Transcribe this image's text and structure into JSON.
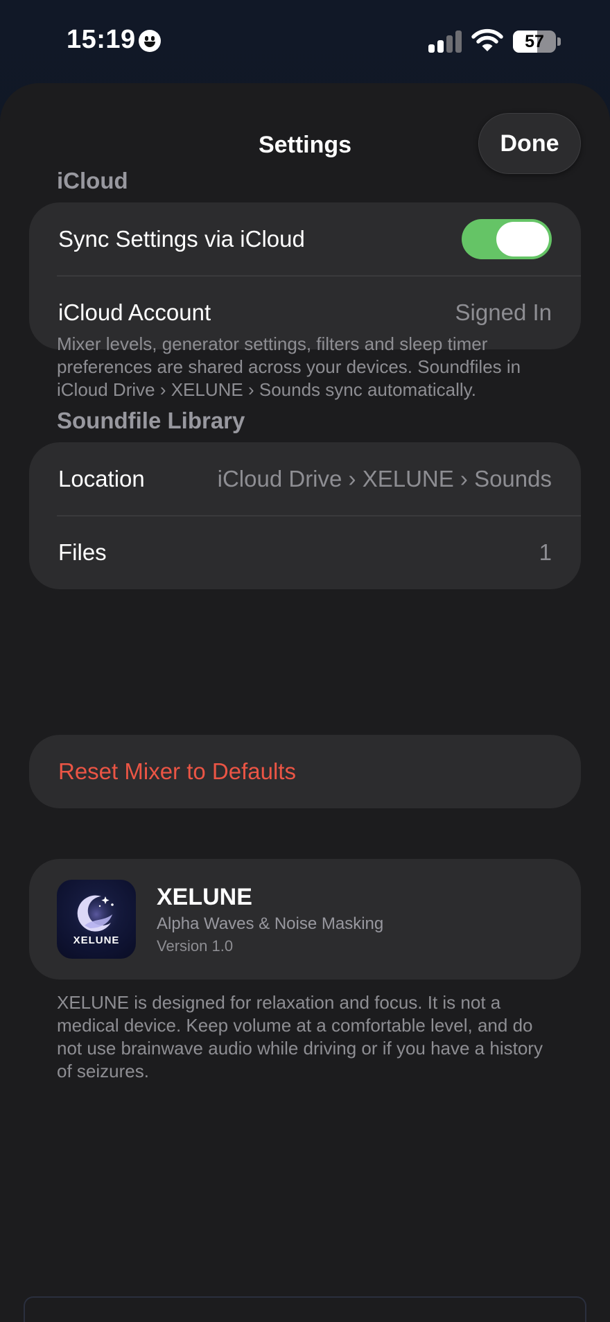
{
  "status_bar": {
    "time": "15:19",
    "battery_percent": "57",
    "battery_level": 0.57,
    "signal_bars_active": 2,
    "signal_bars_total": 4
  },
  "sheet": {
    "title": "Settings",
    "done_label": "Done"
  },
  "icloud": {
    "header": "iCloud",
    "sync_label": "Sync Settings via iCloud",
    "sync_enabled": true,
    "account_label": "iCloud Account",
    "account_value": "Signed In",
    "footnote": "Mixer levels, generator settings, filters and sleep timer preferences are shared across your devices. Soundfiles in iCloud Drive › XELUNE › Sounds sync automatically."
  },
  "library": {
    "header": "Soundfile Library",
    "location_label": "Location",
    "location_value": "iCloud Drive › XELUNE › Sounds",
    "files_label": "Files",
    "files_value": "1"
  },
  "reset": {
    "label": "Reset Mixer to Defaults"
  },
  "about": {
    "icon_text": "XELUNE",
    "app_name": "XELUNE",
    "subtitle": "Alpha Waves & Noise Masking",
    "version": "Version 1.0",
    "disclaimer": "XELUNE is designed for relaxation and focus. It is not a medical device. Keep volume at a comfortable level, and do not use brainwave audio while driving or if you have a history of seizures."
  },
  "colors": {
    "toggle_on": "#65c466",
    "destructive": "#eb5545",
    "sheet_bg": "#1c1c1e",
    "card_bg": "#2c2c2e"
  },
  "icons": {
    "status_emoji": "smiley-icon",
    "signal": "cellular-signal-icon",
    "wifi": "wifi-icon",
    "battery": "battery-icon",
    "app_icon": "moon-wave-app-icon"
  }
}
